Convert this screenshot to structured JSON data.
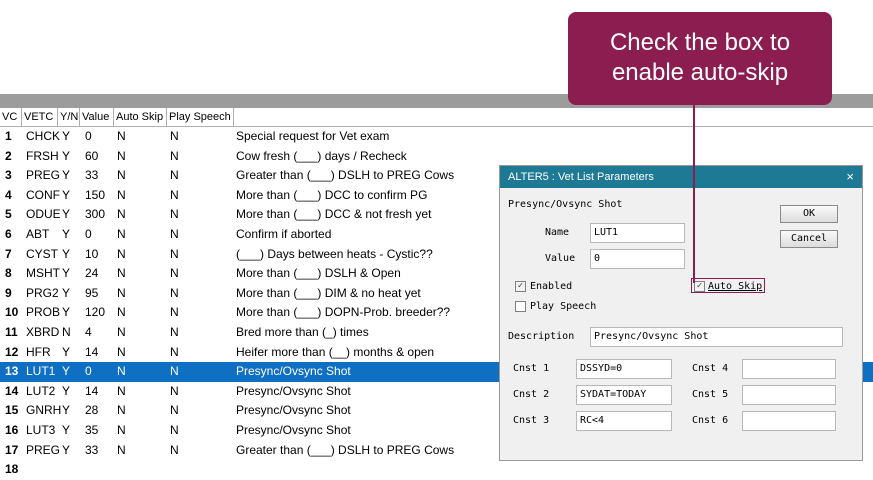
{
  "columns": [
    "VC",
    "VETC",
    "Y/N",
    "Value",
    "Auto Skip",
    "Play Speech"
  ],
  "rows": [
    {
      "vc": "1",
      "vetc": "CHCK",
      "yn": "Y",
      "value": "0",
      "auto_skip": "N",
      "play_speech": "N",
      "desc": "Special request for Vet exam"
    },
    {
      "vc": "2",
      "vetc": "FRSH",
      "yn": "Y",
      "value": "60",
      "auto_skip": "N",
      "play_speech": "N",
      "desc": "Cow fresh (___) days / Recheck"
    },
    {
      "vc": "3",
      "vetc": "PREG",
      "yn": "Y",
      "value": "33",
      "auto_skip": "N",
      "play_speech": "N",
      "desc": "Greater than (___) DSLH to PREG Cows"
    },
    {
      "vc": "4",
      "vetc": "CONF",
      "yn": "Y",
      "value": "150",
      "auto_skip": "N",
      "play_speech": "N",
      "desc": "More than (___) DCC to confirm PG"
    },
    {
      "vc": "5",
      "vetc": "ODUE",
      "yn": "Y",
      "value": "300",
      "auto_skip": "N",
      "play_speech": "N",
      "desc": "More than (___) DCC & not fresh yet"
    },
    {
      "vc": "6",
      "vetc": "ABT",
      "yn": "Y",
      "value": "0",
      "auto_skip": "N",
      "play_speech": "N",
      "desc": "Confirm if aborted"
    },
    {
      "vc": "7",
      "vetc": "CYST",
      "yn": "Y",
      "value": "10",
      "auto_skip": "N",
      "play_speech": "N",
      "desc": "(___) Days between heats - Cystic??"
    },
    {
      "vc": "8",
      "vetc": "MSHT",
      "yn": "Y",
      "value": "24",
      "auto_skip": "N",
      "play_speech": "N",
      "desc": "More than (___) DSLH & Open"
    },
    {
      "vc": "9",
      "vetc": "PRG2",
      "yn": "Y",
      "value": "95",
      "auto_skip": "N",
      "play_speech": "N",
      "desc": "More than (___) DIM & no heat yet"
    },
    {
      "vc": "10",
      "vetc": "PROB",
      "yn": "Y",
      "value": "120",
      "auto_skip": "N",
      "play_speech": "N",
      "desc": "More than (___) DOPN-Prob. breeder??"
    },
    {
      "vc": "11",
      "vetc": "XBRD",
      "yn": "N",
      "value": "4",
      "auto_skip": "N",
      "play_speech": "N",
      "desc": "Bred more than (_) times"
    },
    {
      "vc": "12",
      "vetc": "HFR",
      "yn": "Y",
      "value": "14",
      "auto_skip": "N",
      "play_speech": "N",
      "desc": "Heifer more than (__) months & open"
    },
    {
      "vc": "13",
      "vetc": "LUT1",
      "yn": "Y",
      "value": "0",
      "auto_skip": "N",
      "play_speech": "N",
      "desc": "Presync/Ovsync Shot",
      "selected": true
    },
    {
      "vc": "14",
      "vetc": "LUT2",
      "yn": "Y",
      "value": "14",
      "auto_skip": "N",
      "play_speech": "N",
      "desc": "Presync/Ovsync Shot"
    },
    {
      "vc": "15",
      "vetc": "GNRH",
      "yn": "Y",
      "value": "28",
      "auto_skip": "N",
      "play_speech": "N",
      "desc": "Presync/Ovsync Shot"
    },
    {
      "vc": "16",
      "vetc": "LUT3",
      "yn": "Y",
      "value": "35",
      "auto_skip": "N",
      "play_speech": "N",
      "desc": "Presync/Ovsync Shot"
    },
    {
      "vc": "17",
      "vetc": "PREG",
      "yn": "Y",
      "value": "33",
      "auto_skip": "N",
      "play_speech": "N",
      "desc": "Greater than (___) DSLH to PREG Cows"
    },
    {
      "vc": "18",
      "vetc": "",
      "yn": "",
      "value": "",
      "auto_skip": "",
      "play_speech": "",
      "desc": ""
    }
  ],
  "dialog": {
    "title": "ALTER5 : Vet List Parameters",
    "close_glyph": "×",
    "heading": "Presync/Ovsync Shot",
    "name_label": "Name",
    "name_value": "LUT1",
    "value_label": "Value",
    "value_value": "0",
    "ok_label": "OK",
    "cancel_label": "Cancel",
    "enabled_label": "Enabled",
    "enabled_checked": true,
    "auto_skip_label": "Auto Skip",
    "auto_skip_checked": true,
    "play_speech_label": "Play Speech",
    "play_speech_checked": false,
    "description_label": "Description",
    "description_value": "Presync/Ovsync Shot",
    "cnst1_label": "Cnst 1",
    "cnst1_value": "DSSYD=0",
    "cnst2_label": "Cnst 2",
    "cnst2_value": "SYDAT=TODAY",
    "cnst3_label": "Cnst 3",
    "cnst3_value": "RC<4",
    "cnst4_label": "Cnst 4",
    "cnst4_value": "",
    "cnst5_label": "Cnst 5",
    "cnst5_value": "",
    "cnst6_label": "Cnst 6",
    "cnst6_value": ""
  },
  "callout": {
    "line1": "Check the box to",
    "line2": "enable auto-skip"
  },
  "colors": {
    "selection": "#0f6fc2",
    "dialog_title": "#1e7a94",
    "callout": "#8c1d51"
  },
  "check_glyph": "✓"
}
